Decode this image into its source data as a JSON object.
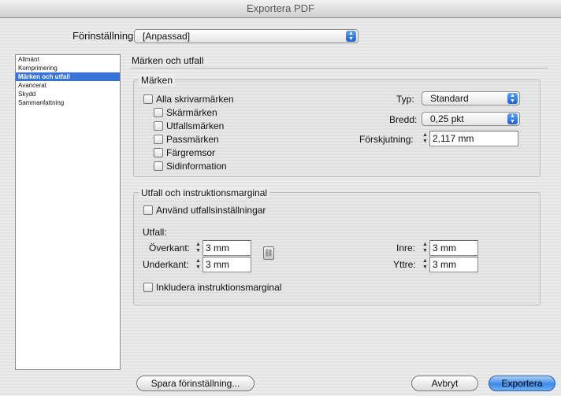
{
  "window": {
    "title": "Exportera PDF"
  },
  "preset": {
    "label": "Förinställning:",
    "value": "[Anpassad]"
  },
  "sidebar": {
    "items": [
      {
        "label": "Allmänt",
        "selected": false
      },
      {
        "label": "Komprimering",
        "selected": false
      },
      {
        "label": "Märken och utfall",
        "selected": true
      },
      {
        "label": "Avancerat",
        "selected": false
      },
      {
        "label": "Skydd",
        "selected": false
      },
      {
        "label": "Sammanfattning",
        "selected": false
      }
    ]
  },
  "panel": {
    "title": "Märken och utfall"
  },
  "marks": {
    "legend": "Märken",
    "all_printer_marks": "Alla skrivarmärken",
    "crop_marks": "Skärmärken",
    "bleed_marks": "Utfallsmärken",
    "registration_marks": "Passmärken",
    "color_bars": "Färgremsor",
    "page_info": "Sidinformation",
    "type_label": "Typ:",
    "type_value": "Standard",
    "weight_label": "Bredd:",
    "weight_value": "0,25 pkt",
    "offset_label": "Förskjutning:",
    "offset_value": "2,117 mm"
  },
  "bleed": {
    "legend": "Utfall och instruktionsmarginal",
    "use_doc_settings": "Använd utfallsinställningar",
    "bleed_heading": "Utfall:",
    "top_label": "Överkant:",
    "top_value": "3 mm",
    "bottom_label": "Underkant:",
    "bottom_value": "3 mm",
    "inside_label": "Inre:",
    "inside_value": "3 mm",
    "outside_label": "Yttre:",
    "outside_value": "3 mm",
    "include_slug": "Inkludera instruktionsmarginal"
  },
  "buttons": {
    "save_preset": "Spara förinställning...",
    "cancel": "Avbryt",
    "export": "Exportera"
  },
  "colors": {
    "accent": "#3874d7",
    "background": "#a9c4dd"
  }
}
